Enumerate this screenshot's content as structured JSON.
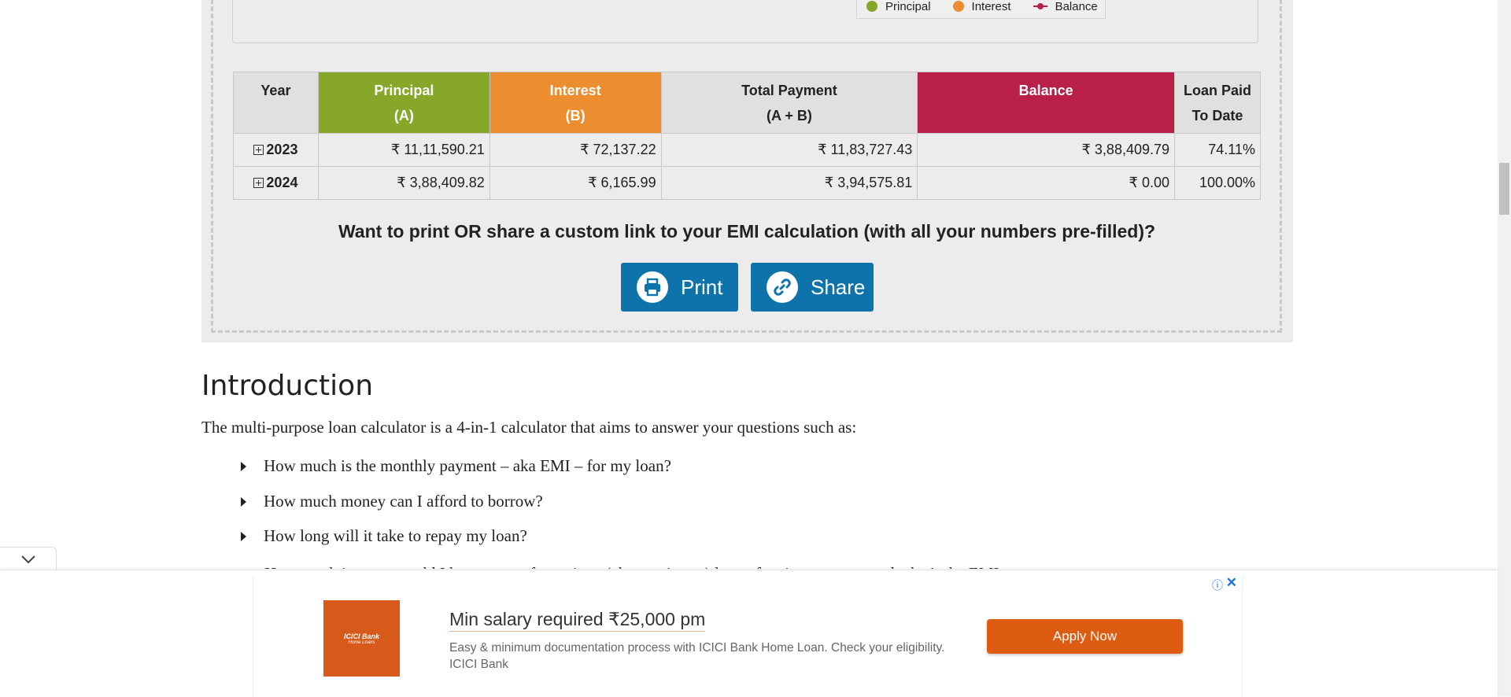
{
  "chart_legend": {
    "items": [
      {
        "label": "Principal",
        "color": "#86a72a",
        "marker": "dot"
      },
      {
        "label": "Interest",
        "color": "#ec8d2f",
        "marker": "dot"
      },
      {
        "label": "Balance",
        "color": "#b8204a",
        "marker": "line-dot"
      }
    ]
  },
  "table": {
    "headers": {
      "year": "Year",
      "principal_1": "Principal",
      "principal_2": "(A)",
      "interest_1": "Interest",
      "interest_2": "(B)",
      "total_1": "Total Payment",
      "total_2": "(A + B)",
      "balance": "Balance",
      "paid_1": "Loan Paid",
      "paid_2": "To Date"
    },
    "rows": [
      {
        "year": "2023",
        "principal": "₹ 11,11,590.21",
        "interest": "₹ 72,137.22",
        "total": "₹ 11,83,727.43",
        "balance": "₹ 3,88,409.79",
        "paid": "74.11%"
      },
      {
        "year": "2024",
        "principal": "₹ 3,88,409.82",
        "interest": "₹ 6,165.99",
        "total": "₹ 3,94,575.81",
        "balance": "₹ 0.00",
        "paid": "100.00%"
      }
    ]
  },
  "share_prompt": "Want to print OR share a custom link to your EMI calculation (with all your numbers pre-filled)?",
  "buttons": {
    "print": "Print",
    "share": "Share"
  },
  "article": {
    "heading": "Introduction",
    "intro": "The multi-purpose loan calculator is a 4-in-1 calculator that aims to answer your questions such as:",
    "questions": [
      "How much is the monthly payment – aka EMI – for my loan?",
      "How much money can I afford to borrow?",
      "How long will it take to repay my loan?"
    ],
    "partial": "How much interest would I have to pay for a given (aka maximum) loan of an interest rate, and what's the EMI ..."
  },
  "ad": {
    "logo_line1": "ICICI Bank",
    "logo_line2": "Home Loans",
    "title": "Min salary required ₹25,000 pm",
    "description": "Easy & minimum documentation process with ICICI Bank Home Loan. Check your eligibility. ICICI Bank",
    "cta": "Apply Now",
    "info_icon": "info-icon",
    "close_icon": "close-icon"
  },
  "colors": {
    "button_blue": "#0f73ab",
    "ad_orange": "#de5b12"
  }
}
